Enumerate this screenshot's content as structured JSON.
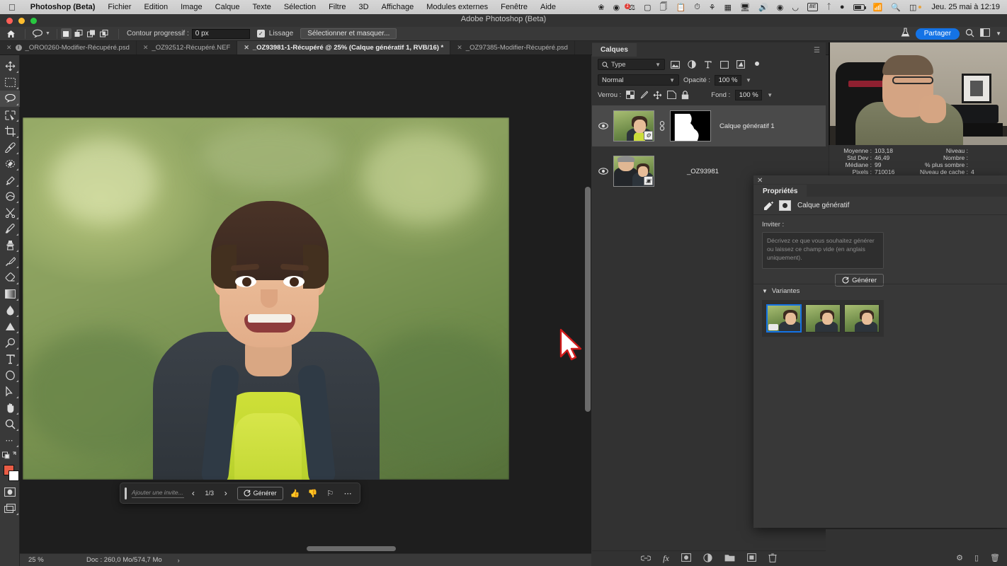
{
  "macbar": {
    "apple": "apple-logo",
    "app_name": "Photoshop (Beta)",
    "menus": [
      "Fichier",
      "Edition",
      "Image",
      "Calque",
      "Texte",
      "Sélection",
      "Filtre",
      "3D",
      "Affichage",
      "Modules externes",
      "Fenêtre",
      "Aide"
    ],
    "status_icons": [
      "butterfly-icon",
      "ghost-icon",
      "alarm-badge-icon",
      "screen-record-icon",
      "copy-icon",
      "clipboard-icon",
      "clock-icon",
      "binoculars-icon",
      "columns-icon",
      "display-icon",
      "volume-icon",
      "timemachine-icon",
      "headphone-icon",
      "be-icon",
      "bluetooth-icon",
      "user-icon",
      "battery-icon",
      "wifi-icon",
      "search-icon",
      "control-center-icon"
    ],
    "be_label": "BE",
    "clock": "Jeu. 25 mai à 12:19"
  },
  "window": {
    "title": "Adobe Photoshop (Beta)"
  },
  "options_bar": {
    "home_icon": "home-icon",
    "tool_icon": "lasso-icon",
    "tool_caret": "chevron-down-icon",
    "modes": [
      "new-selection-icon",
      "add-selection-icon",
      "subtract-selection-icon",
      "intersect-selection-icon"
    ],
    "feather_label": "Contour progressif :",
    "feather_value": "0 px",
    "antialias_label": "Lissage",
    "antialias_checked": true,
    "select_mask_button": "Sélectionner et masquer...",
    "right_icons": [
      "flask-icon",
      "search-icon",
      "workspace-icon",
      "chevron-down-icon"
    ],
    "share_label": "Partager"
  },
  "tabs": [
    {
      "label": "_ORO0260-Modifier-Récupéré.psd",
      "active": false,
      "pinned": true
    },
    {
      "label": "_OZ92512-Récupéré.NEF",
      "active": false,
      "pinned": false
    },
    {
      "label": "_OZ93981-1-Récupéré @ 25% (Calque génératif 1, RVB/16) *",
      "active": true,
      "pinned": false
    },
    {
      "label": "_OZ97385-Modifier-Récupéré.psd",
      "active": false,
      "pinned": false
    }
  ],
  "tabs_overflow": "»",
  "toolbar": {
    "tools": [
      {
        "name": "move-tool",
        "icon": "move-icon",
        "active": false
      },
      {
        "name": "marquee-tool",
        "icon": "rect-marquee-icon",
        "active": false
      },
      {
        "name": "lasso-tool",
        "icon": "lasso-icon",
        "active": true
      },
      {
        "name": "quick-selection-tool",
        "icon": "quick-select-icon",
        "active": false
      },
      {
        "name": "crop-tool",
        "icon": "crop-icon",
        "active": false
      },
      {
        "name": "eyedropper-tool",
        "icon": "eyedropper-icon",
        "active": false
      },
      {
        "name": "spot-healing-tool",
        "icon": "healing-icon",
        "active": false
      },
      {
        "name": "patch-tool",
        "icon": "patch-icon",
        "active": false
      },
      {
        "name": "remove-tool",
        "icon": "remove-icon",
        "active": false
      },
      {
        "name": "scissors-tool",
        "icon": "scissors-icon",
        "active": false
      },
      {
        "name": "brush-tool",
        "icon": "brush-icon",
        "active": false
      },
      {
        "name": "clone-stamp-tool",
        "icon": "stamp-icon",
        "active": false
      },
      {
        "name": "history-brush-tool",
        "icon": "history-brush-icon",
        "active": false
      },
      {
        "name": "eraser-tool",
        "icon": "eraser-icon",
        "active": false
      },
      {
        "name": "gradient-tool",
        "icon": "gradient-icon",
        "active": false
      },
      {
        "name": "blur-tool",
        "icon": "blur-drop-icon",
        "active": false
      },
      {
        "name": "dodge-tool",
        "icon": "dodge-icon",
        "active": false
      },
      {
        "name": "pen-tool",
        "icon": "pen-icon",
        "active": false
      },
      {
        "name": "type-tool",
        "icon": "type-icon",
        "active": false
      },
      {
        "name": "shape-tool",
        "icon": "shape-icon",
        "active": false
      },
      {
        "name": "path-selection-tool",
        "icon": "arrow-select-icon",
        "active": false
      },
      {
        "name": "hand-tool",
        "icon": "hand-icon",
        "active": false
      },
      {
        "name": "zoom-tool",
        "icon": "magnifier-icon",
        "active": false
      },
      {
        "name": "more-tools",
        "icon": "ellipsis-icon",
        "active": false
      },
      {
        "name": "default-colors",
        "icon": "default-colors-icon",
        "active": false
      },
      {
        "name": "swap-colors",
        "icon": "swap-arrow-icon",
        "active": false
      }
    ],
    "foreground_color": "#e85c45",
    "background_color": "#ffffff",
    "quick_mask_icon": "quick-mask-icon",
    "screen_mode_icon": "screen-mode-icon"
  },
  "canvas": {
    "contextual_bar": {
      "grip_icon": "drag-grip-icon",
      "prompt_placeholder": "Ajouter une invite...",
      "prev_icon": "chevron-left-icon",
      "counter": "1/3",
      "next_icon": "chevron-right-icon",
      "generate_label": "Générer",
      "generate_icon": "refresh-icon",
      "thumbs_up_icon": "thumbs-up-icon",
      "thumbs_down_icon": "thumbs-down-icon",
      "flag_icon": "flag-icon",
      "more_icon": "ellipsis-icon"
    }
  },
  "status_bar": {
    "zoom": "25 %",
    "doc": "Doc : 260,0 Mo/574,7 Mo",
    "caret": "›"
  },
  "layers_panel": {
    "title": "Calques",
    "menu_icon": "panel-menu-icon",
    "filter": {
      "icon": "search-icon",
      "label": "Type",
      "caret": "chevron-down-icon"
    },
    "filter_icons": [
      "image-filter-icon",
      "adjustment-filter-icon",
      "type-filter-icon",
      "shape-filter-icon",
      "smartobject-filter-icon",
      "filter-toggle-icon"
    ],
    "blend_mode": "Normal",
    "opacity_label": "Opacité :",
    "opacity_value": "100 %",
    "lock_label": "Verrou :",
    "lock_icons": [
      "lock-transparent-icon",
      "lock-image-icon",
      "lock-position-icon",
      "lock-nesting-icon",
      "lock-all-icon"
    ],
    "fill_label": "Fond :",
    "fill_value": "100 %",
    "layers": [
      {
        "name": "Calque génératif 1",
        "selected": true,
        "visible": true,
        "has_mask": true,
        "link_icon": "link-icon"
      },
      {
        "name": "_OZ93981",
        "selected": false,
        "visible": true,
        "has_mask": false,
        "badge_icon": "smart-object-icon"
      }
    ],
    "footer_icons": [
      "link-layers-icon",
      "fx-icon",
      "add-mask-icon",
      "adjustment-layer-icon",
      "new-group-icon",
      "new-layer-icon",
      "delete-layer-icon"
    ]
  },
  "histogram": {
    "rows": [
      {
        "key": "Moyenne :",
        "value": "103,18",
        "key2": "Niveau :",
        "value2": ""
      },
      {
        "key": "Std Dev :",
        "value": "46,49",
        "key2": "Nombre :",
        "value2": ""
      },
      {
        "key": "Médiane :",
        "value": "99",
        "key2": "% plus sombre :",
        "value2": ""
      },
      {
        "key": "Pixels :",
        "value": "710016",
        "key2": "Niveau de cache :",
        "value2": "4"
      }
    ]
  },
  "properties_panel": {
    "close_icon": "close-icon",
    "tab_label": "Propriétés",
    "layer_icon": "generative-layer-icon",
    "mask_icon": "mask-thumb-icon",
    "header_title": "Calque génératif",
    "prompt_label": "Inviter :",
    "prompt_placeholder": "Décrivez ce que vous souhaitez générer ou laissez ce champ vide (en anglais uniquement).",
    "generate_label": "Générer",
    "generate_icon": "refresh-icon",
    "variants_label": "Variantes",
    "variants_caret": "chevron-down-icon",
    "variants": [
      {
        "name": "variant-1",
        "selected": true
      },
      {
        "name": "variant-2",
        "selected": false
      },
      {
        "name": "variant-3",
        "selected": false
      }
    ]
  },
  "right_strip": {
    "icons": [
      "settings-icon",
      "layout-icon",
      "trash-icon"
    ]
  }
}
